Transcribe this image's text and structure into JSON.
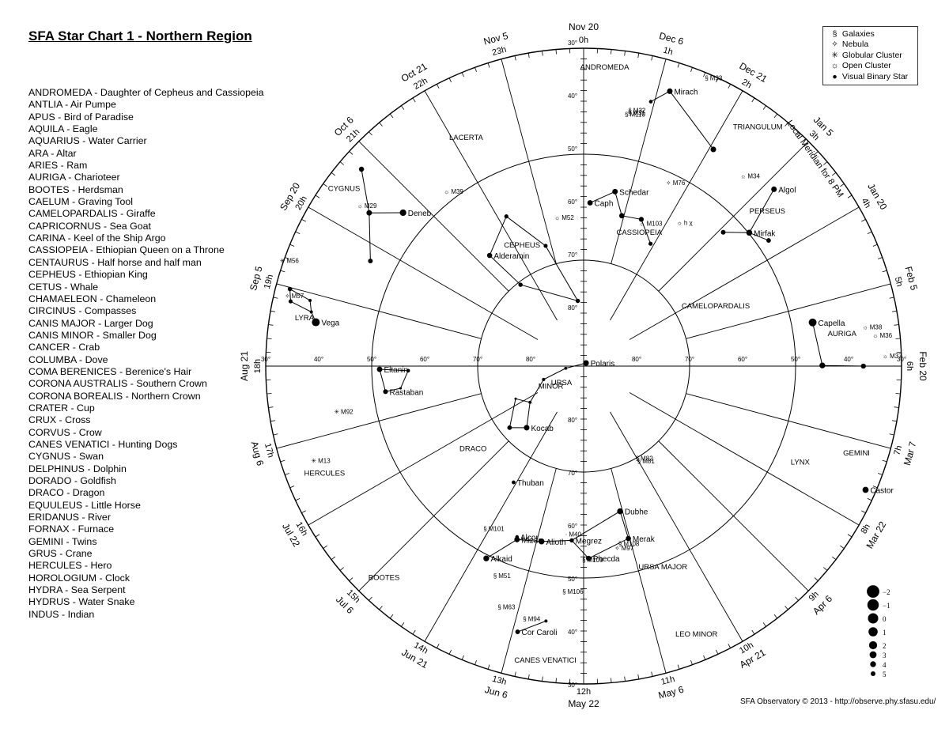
{
  "title": "SFA Star Chart 1 - Northern Region",
  "constellation_list": [
    "ANDROMEDA - Daughter of Cepheus and Cassiopeia",
    "ANTLIA - Air Pumpe",
    "APUS - Bird of Paradise",
    "AQUILA - Eagle",
    "AQUARIUS - Water Carrier",
    "ARA - Altar",
    "ARIES - Ram",
    "AURIGA - Charioteer",
    "BOOTES - Herdsman",
    "CAELUM - Graving Tool",
    "CAMELOPARDALIS - Giraffe",
    "CAPRICORNUS - Sea Goat",
    "CARINA - Keel of the Ship Argo",
    "CASSIOPEIA - Ethiopian Queen on a Throne",
    "CENTAURUS - Half horse and half man",
    "CEPHEUS - Ethiopian King",
    "CETUS - Whale",
    "CHAMAELEON - Chameleon",
    "CIRCINUS - Compasses",
    "CANIS MAJOR - Larger Dog",
    "CANIS MINOR - Smaller Dog",
    "CANCER - Crab",
    "COLUMBA - Dove",
    "COMA BERENICES - Berenice's Hair",
    "CORONA AUSTRALIS - Southern Crown",
    "CORONA BOREALIS - Northern Crown",
    "CRATER - Cup",
    "CRUX - Cross",
    "CORVUS - Crow",
    "CANES VENATICI - Hunting Dogs",
    "CYGNUS - Swan",
    "DELPHINUS - Dolphin",
    "DORADO - Goldfish",
    "DRACO - Dragon",
    "EQUULEUS - Little Horse",
    "ERIDANUS - River",
    "FORNAX - Furnace",
    "GEMINI - Twins",
    "GRUS - Crane",
    "HERCULES - Hero",
    "HOROLOGIUM - Clock",
    "HYDRA - Sea Serpent",
    "HYDRUS - Water Snake",
    "INDUS - Indian"
  ],
  "legend": [
    {
      "symbol": "§",
      "label": "Galaxies"
    },
    {
      "symbol": "✧",
      "label": "Nebula"
    },
    {
      "symbol": "✳",
      "label": "Globular Cluster"
    },
    {
      "symbol": "☼",
      "label": "Open Cluster"
    },
    {
      "symbol": "●",
      "label": "Visual Binary Star"
    }
  ],
  "meridian_label": "Local Meridian for 8 PM",
  "footer": "SFA Observatory © 2013 - http://observe.phy.sfasu.edu/",
  "chart_data": {
    "type": "polar-star-map",
    "projection": "north polar, RA clockwise from top, declination 90° at center to 30° at edge",
    "dec_range": [
      30,
      90
    ],
    "dec_circles": [
      30,
      50,
      70
    ],
    "dec_labels": [
      "30°",
      "40°",
      "50°",
      "60°",
      "70°",
      "80°"
    ],
    "hour_marks": [
      {
        "ra": 0,
        "label": "0h",
        "date": "Nov 20"
      },
      {
        "ra": 1,
        "label": "1h",
        "date": "Dec 6"
      },
      {
        "ra": 2,
        "label": "2h",
        "date": "Dec 21"
      },
      {
        "ra": 3,
        "label": "3h",
        "date": "Jan 5"
      },
      {
        "ra": 4,
        "label": "4h",
        "date": "Jan 20"
      },
      {
        "ra": 5,
        "label": "5h",
        "date": "Feb 5"
      },
      {
        "ra": 6,
        "label": "6h",
        "date": "Feb 20"
      },
      {
        "ra": 7,
        "label": "7h",
        "date": "Mar 7"
      },
      {
        "ra": 8,
        "label": "8h",
        "date": "Mar 22"
      },
      {
        "ra": 9,
        "label": "9h",
        "date": "Apr 6"
      },
      {
        "ra": 10,
        "label": "10h",
        "date": "Apr 21"
      },
      {
        "ra": 11,
        "label": "11h",
        "date": "May 6"
      },
      {
        "ra": 12,
        "label": "12h",
        "date": "May 22"
      },
      {
        "ra": 13,
        "label": "13h",
        "date": "Jun 6"
      },
      {
        "ra": 14,
        "label": "14h",
        "date": "Jun 21"
      },
      {
        "ra": 15,
        "label": "15h",
        "date": "Jul 6"
      },
      {
        "ra": 16,
        "label": "16h",
        "date": "Jul 22"
      },
      {
        "ra": 17,
        "label": "17h",
        "date": "Aug 6"
      },
      {
        "ra": 18,
        "label": "18h",
        "date": "Aug 21"
      },
      {
        "ra": 19,
        "label": "19h",
        "date": "Sep 5"
      },
      {
        "ra": 20,
        "label": "20h",
        "date": "Sep 20"
      },
      {
        "ra": 21,
        "label": "21h",
        "date": "Oct 6"
      },
      {
        "ra": 22,
        "label": "22h",
        "date": "Oct 21"
      },
      {
        "ra": 23,
        "label": "23h",
        "date": "Nov 5"
      }
    ],
    "stars": [
      {
        "id": "polaris",
        "name": "Polaris",
        "ra": 2.53,
        "dec": 89.26,
        "mag": 2.0
      },
      {
        "id": "kocab",
        "name": "Kocab",
        "ra": 14.85,
        "dec": 74.16,
        "mag": 2.1
      },
      {
        "id": "pherkad",
        "name": "",
        "ra": 15.35,
        "dec": 71.83,
        "mag": 3.0
      },
      {
        "id": "dumi",
        "name": "",
        "ra": 17.54,
        "dec": 86.59,
        "mag": 4.4
      },
      {
        "id": "eumi",
        "name": "",
        "ra": 16.77,
        "dec": 82.04,
        "mag": 4.2
      },
      {
        "id": "zumi",
        "name": "",
        "ra": 15.73,
        "dec": 77.79,
        "mag": 4.3
      },
      {
        "id": "humi",
        "name": "",
        "ra": 16.29,
        "dec": 75.76,
        "mag": 5.0
      },
      {
        "id": "capella",
        "name": "Capella",
        "ra": 5.28,
        "dec": 46.0,
        "mag": 0.1
      },
      {
        "id": "baur",
        "name": "",
        "ra": 5.99,
        "dec": 44.95,
        "mag": 1.9
      },
      {
        "id": "taur",
        "name": "",
        "ra": 6.0,
        "dec": 37.2,
        "mag": 2.6
      },
      {
        "id": "vega",
        "name": "Vega",
        "ra": 18.62,
        "dec": 38.78,
        "mag": 0.0
      },
      {
        "id": "zlyr",
        "name": "",
        "ra": 18.75,
        "dec": 37.6,
        "mag": 4.3
      },
      {
        "id": "dlyr",
        "name": "",
        "ra": 18.9,
        "dec": 36.9,
        "mag": 4.3
      },
      {
        "id": "glyr",
        "name": "",
        "ra": 18.98,
        "dec": 32.69,
        "mag": 3.2
      },
      {
        "id": "blyr",
        "name": "",
        "ra": 18.83,
        "dec": 33.36,
        "mag": 3.5
      },
      {
        "id": "deneb",
        "name": "Deneb",
        "ra": 20.69,
        "dec": 45.28,
        "mag": 1.25
      },
      {
        "id": "gcyg",
        "name": "",
        "ra": 20.37,
        "dec": 40.26,
        "mag": 2.2
      },
      {
        "id": "ecyg",
        "name": "",
        "ra": 20.77,
        "dec": 33.97,
        "mag": 2.5
      },
      {
        "id": "dcyg",
        "name": "",
        "ra": 19.75,
        "dec": 45.13,
        "mag": 2.9
      },
      {
        "id": "alderamin",
        "name": "Alderamin",
        "ra": 21.31,
        "dec": 62.59,
        "mag": 2.5
      },
      {
        "id": "bcep",
        "name": "",
        "ra": 21.48,
        "dec": 70.56,
        "mag": 3.2
      },
      {
        "id": "gcep",
        "name": "",
        "ra": 23.66,
        "dec": 77.63,
        "mag": 3.2
      },
      {
        "id": "icep",
        "name": "",
        "ra": 22.83,
        "dec": 66.2,
        "mag": 3.5
      },
      {
        "id": "zcep",
        "name": "",
        "ra": 22.18,
        "dec": 58.2,
        "mag": 3.4
      },
      {
        "id": "caph",
        "name": "Caph",
        "ra": 0.15,
        "dec": 59.15,
        "mag": 2.3
      },
      {
        "id": "schedar",
        "name": "Schedar",
        "ra": 0.68,
        "dec": 56.54,
        "mag": 2.2
      },
      {
        "id": "gcas",
        "name": "",
        "ra": 0.95,
        "dec": 60.72,
        "mag": 2.4
      },
      {
        "id": "ruchbah",
        "name": "",
        "ra": 1.43,
        "dec": 60.24,
        "mag": 2.7
      },
      {
        "id": "segin",
        "name": "",
        "ra": 1.91,
        "dec": 63.67,
        "mag": 3.4
      },
      {
        "id": "mirach",
        "name": "Mirach",
        "ra": 1.16,
        "dec": 35.62,
        "mag": 2.1
      },
      {
        "id": "mand",
        "name": "",
        "ra": 0.95,
        "dec": 38.5,
        "mag": 3.9
      },
      {
        "id": "gand",
        "name": "",
        "ra": 2.06,
        "dec": 42.33,
        "mag": 2.1
      },
      {
        "id": "algol",
        "name": "Algol",
        "ra": 3.14,
        "dec": 40.96,
        "mag": 2.1
      },
      {
        "id": "mirfak",
        "name": "Mirfak",
        "ra": 3.41,
        "dec": 49.86,
        "mag": 1.8
      },
      {
        "id": "gper",
        "name": "",
        "ra": 3.08,
        "dec": 53.5,
        "mag": 2.9
      },
      {
        "id": "dper",
        "name": "",
        "ra": 3.72,
        "dec": 47.79,
        "mag": 3.0
      },
      {
        "id": "dubhe",
        "name": "Dubhe",
        "ra": 11.06,
        "dec": 61.75,
        "mag": 1.8
      },
      {
        "id": "merak",
        "name": "Merak",
        "ra": 11.03,
        "dec": 56.38,
        "mag": 2.4
      },
      {
        "id": "phecda",
        "name": "Phecda",
        "ra": 11.9,
        "dec": 53.69,
        "mag": 2.4
      },
      {
        "id": "megrez",
        "name": "Megrez",
        "ra": 12.26,
        "dec": 57.03,
        "mag": 3.3
      },
      {
        "id": "alioth",
        "name": "Alioth",
        "ra": 12.9,
        "dec": 55.96,
        "mag": 1.8
      },
      {
        "id": "mizar",
        "name": "Mizar",
        "ra": 13.4,
        "dec": 54.93,
        "mag": 2.2
      },
      {
        "id": "alcor",
        "name": "Alcor",
        "ra": 13.42,
        "dec": 55.4,
        "mag": 4.0
      },
      {
        "id": "alkaid",
        "name": "Alkaid",
        "ra": 13.79,
        "dec": 49.31,
        "mag": 1.9
      },
      {
        "id": "thuban",
        "name": "Thuban",
        "ra": 14.07,
        "dec": 64.38,
        "mag": 3.7
      },
      {
        "id": "eltanin",
        "name": "Eltanin",
        "ra": 17.94,
        "dec": 51.49,
        "mag": 2.2
      },
      {
        "id": "rastaban",
        "name": "Rastaban",
        "ra": 17.51,
        "dec": 52.3,
        "mag": 2.8
      },
      {
        "id": "ndra",
        "name": "",
        "ra": 17.54,
        "dec": 55.2,
        "mag": 4.9
      },
      {
        "id": "xdra",
        "name": "",
        "ra": 17.9,
        "dec": 56.87,
        "mag": 3.8
      },
      {
        "id": "corcaroli",
        "name": "Cor Caroli",
        "ra": 12.93,
        "dec": 38.32,
        "mag": 2.9
      },
      {
        "id": "bcvn",
        "name": "",
        "ra": 12.56,
        "dec": 41.36,
        "mag": 4.3
      },
      {
        "id": "castor",
        "name": "Castor",
        "ra": 7.58,
        "dec": 31.89,
        "mag": 1.6
      }
    ],
    "lines": [
      [
        "dubhe",
        "merak",
        "phecda",
        "megrez",
        "dubhe"
      ],
      [
        "megrez",
        "alioth",
        "mizar",
        "alkaid"
      ],
      [
        "caph",
        "schedar",
        "gcas",
        "ruchbah",
        "segin"
      ],
      [
        "polaris",
        "dumi",
        "eumi",
        "zumi",
        "kocab",
        "pherkad",
        "humi",
        "zumi"
      ],
      [
        "eltanin",
        "rastaban",
        "ndra",
        "xdra",
        "eltanin"
      ],
      [
        "alderamin",
        "bcep",
        "gcep",
        "icep",
        "zcep",
        "alderamin"
      ],
      [
        "deneb",
        "gcyg",
        "ecyg"
      ],
      [
        "gcyg",
        "dcyg"
      ],
      [
        "vega",
        "zlyr",
        "dlyr",
        "glyr",
        "blyr",
        "zlyr"
      ],
      [
        "algol",
        "mirfak",
        "gper"
      ],
      [
        "mirfak",
        "dper"
      ],
      [
        "capella",
        "baur",
        "taur"
      ],
      [
        "mirach",
        "mand"
      ],
      [
        "mirach",
        "gand"
      ],
      [
        "corcaroli",
        "bcvn"
      ]
    ],
    "deep_sky": [
      {
        "label": "M31",
        "type": "galaxy",
        "ra": 0.71,
        "dec": 41.3
      },
      {
        "label": "M32",
        "type": "galaxy",
        "ra": 0.71,
        "dec": 40.9
      },
      {
        "label": "M110",
        "type": "galaxy",
        "ra": 0.67,
        "dec": 41.7
      },
      {
        "label": "M33",
        "type": "galaxy",
        "ra": 1.56,
        "dec": 30.7
      },
      {
        "label": "M34",
        "type": "open",
        "ra": 2.7,
        "dec": 42.8
      },
      {
        "label": "M76",
        "type": "nebula",
        "ra": 1.7,
        "dec": 51.6
      },
      {
        "label": "M52",
        "type": "open",
        "ra": 23.4,
        "dec": 61.6
      },
      {
        "label": "M103",
        "type": "open",
        "ra": 1.55,
        "dec": 60.7
      },
      {
        "label": "h χ",
        "type": "open",
        "ra": 2.3,
        "dec": 57.1
      },
      {
        "label": "M39",
        "type": "open",
        "ra": 21.5,
        "dec": 48.4
      },
      {
        "label": "M29",
        "type": "open",
        "ra": 20.4,
        "dec": 38.5
      },
      {
        "label": "M56",
        "type": "globular",
        "ra": 19.3,
        "dec": 30.2
      },
      {
        "label": "M57",
        "type": "nebula",
        "ra": 18.9,
        "dec": 33.0
      },
      {
        "label": "M92",
        "type": "globular",
        "ra": 17.3,
        "dec": 43.1
      },
      {
        "label": "M13",
        "type": "globular",
        "ra": 16.7,
        "dec": 36.5
      },
      {
        "label": "M81",
        "type": "galaxy",
        "ra": 9.93,
        "dec": 69.1
      },
      {
        "label": "M82",
        "type": "galaxy",
        "ra": 9.93,
        "dec": 69.7
      },
      {
        "label": "M101",
        "type": "galaxy",
        "ra": 14.05,
        "dec": 54.3
      },
      {
        "label": "M40",
        "type": "other",
        "ra": 12.37,
        "dec": 58.1
      },
      {
        "label": "M108",
        "type": "galaxy",
        "ra": 11.19,
        "dec": 55.7
      },
      {
        "label": "M97",
        "type": "nebula",
        "ra": 11.25,
        "dec": 55.0
      },
      {
        "label": "M109",
        "type": "galaxy",
        "ra": 11.96,
        "dec": 53.4
      },
      {
        "label": "M106",
        "type": "galaxy",
        "ra": 12.3,
        "dec": 47.3
      },
      {
        "label": "M51",
        "type": "galaxy",
        "ra": 13.5,
        "dec": 47.2
      },
      {
        "label": "M63",
        "type": "galaxy",
        "ra": 13.26,
        "dec": 42.0
      },
      {
        "label": "M94",
        "type": "galaxy",
        "ra": 12.85,
        "dec": 41.1
      },
      {
        "label": "M38",
        "type": "open",
        "ra": 5.48,
        "dec": 35.8
      },
      {
        "label": "M36",
        "type": "open",
        "ra": 5.6,
        "dec": 34.1
      },
      {
        "label": "M37",
        "type": "open",
        "ra": 5.87,
        "dec": 32.5
      }
    ],
    "constellation_labels": [
      {
        "label": "ANDROMEDA",
        "ra": 0.27,
        "dec": 33.9
      },
      {
        "label": "TRIANGULUM",
        "ra": 2.42,
        "dec": 34.5
      },
      {
        "label": "PERSEUS",
        "ra": 3.35,
        "dec": 44.9
      },
      {
        "label": "CASSIOPEIA",
        "ra": 1.53,
        "dec": 63.1
      },
      {
        "label": "CEPHEUS",
        "ra": 22.17,
        "dec": 64.8
      },
      {
        "label": "LACERTA",
        "ra": 22.17,
        "dec": 41.9
      },
      {
        "label": "CYGNUS",
        "ra": 20.41,
        "dec": 34.0
      },
      {
        "label": "LYRA",
        "ra": 18.62,
        "dec": 36.6
      },
      {
        "label": "CAMELOPARDALIS",
        "ra": 4.43,
        "dec": 62.8
      },
      {
        "label": "AURIGA",
        "ra": 5.56,
        "dec": 40.9
      },
      {
        "label": "GEMINI",
        "ra": 7.21,
        "dec": 35.8
      },
      {
        "label": "LYNX",
        "ra": 7.63,
        "dec": 45.1
      },
      {
        "label": "URSA MAJOR",
        "ra": 10.58,
        "dec": 48.8
      },
      {
        "label": "LEO MINOR",
        "ra": 10.49,
        "dec": 34.7
      },
      {
        "label": "CANES VENATICI",
        "ra": 12.49,
        "dec": 33.6
      },
      {
        "label": "BOOTES",
        "ra": 14.87,
        "dec": 34.8
      },
      {
        "label": "HERCULES",
        "ra": 16.47,
        "dec": 36.9
      },
      {
        "label": "DRACO",
        "ra": 15.5,
        "dec": 63.7
      },
      {
        "label": "URSA",
        "ra": 15.3,
        "dec": 84.5
      },
      {
        "label": "MINOR",
        "ra": 15.7,
        "dec": 82.5
      }
    ],
    "magnitude_key": [
      -2,
      -1,
      0,
      1,
      2,
      3,
      4,
      5
    ],
    "magnitude_key_labels": [
      "−2",
      "−1",
      "0",
      "1",
      "2",
      "3",
      "4",
      "5"
    ]
  }
}
